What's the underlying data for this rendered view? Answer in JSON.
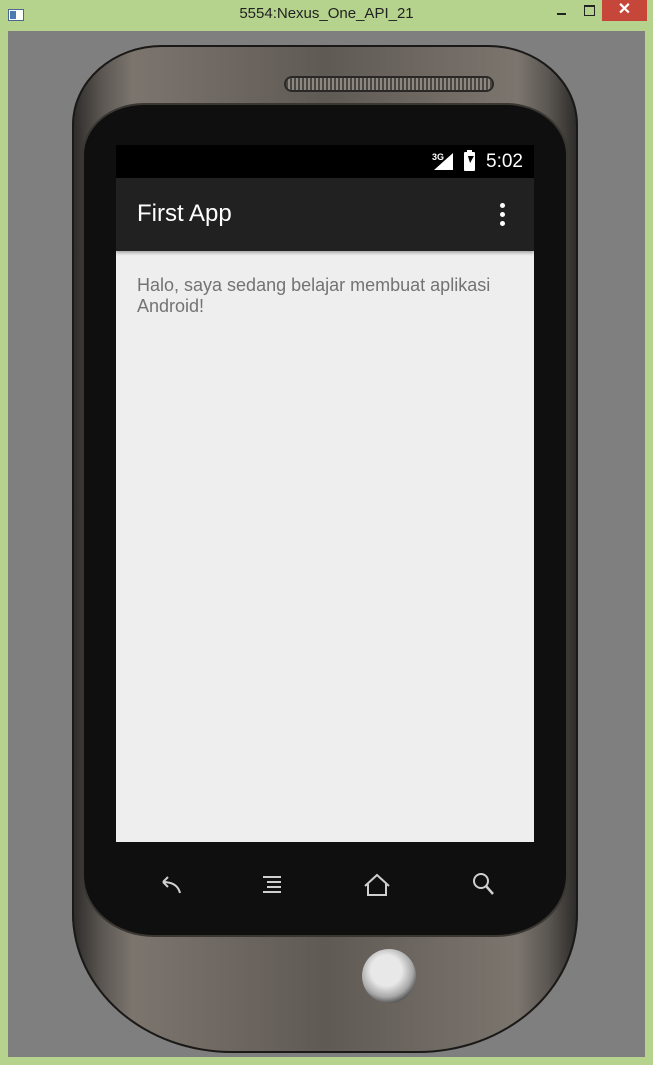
{
  "window": {
    "title": "5554:Nexus_One_API_21",
    "close_label": "✕"
  },
  "status_bar": {
    "network_label": "3G",
    "time": "5:02"
  },
  "action_bar": {
    "title": "First App"
  },
  "content": {
    "message": "Halo, saya sedang belajar membuat aplikasi Android!"
  },
  "nav_keys": [
    "back-icon",
    "menu-icon",
    "home-icon",
    "search-icon"
  ]
}
